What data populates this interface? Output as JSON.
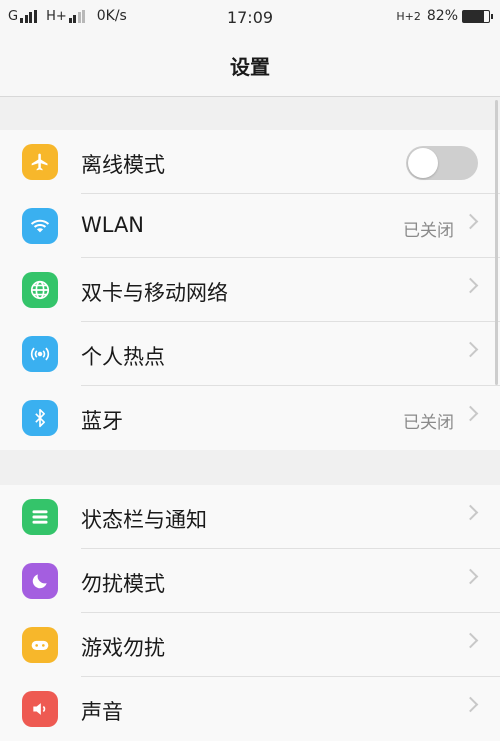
{
  "status_bar": {
    "net1": "G",
    "net2": "H+",
    "speed": "0K/s",
    "time": "17:09",
    "right_net": "H+2",
    "battery": "82%",
    "battery_level": 82
  },
  "nav": {
    "title": "设置"
  },
  "groups": [
    {
      "items": [
        {
          "label": "离线模式",
          "icon": "airplane-icon",
          "color": "#f7b72b",
          "control": "toggle",
          "toggle_on": false
        },
        {
          "label": "WLAN",
          "icon": "wifi-icon",
          "color": "#3ab0f0",
          "status": "已关闭"
        },
        {
          "label": "双卡与移动网络",
          "icon": "globe-icon",
          "color": "#34c46a"
        },
        {
          "label": "个人热点",
          "icon": "hotspot-icon",
          "color": "#3ab0f0"
        },
        {
          "label": "蓝牙",
          "icon": "bluetooth-icon",
          "color": "#3ab0f0",
          "status": "已关闭"
        }
      ]
    },
    {
      "items": [
        {
          "label": "状态栏与通知",
          "icon": "notification-icon",
          "color": "#34c46a"
        },
        {
          "label": "勿扰模式",
          "icon": "moon-icon",
          "color": "#a45ee0"
        },
        {
          "label": "游戏勿扰",
          "icon": "gamepad-icon",
          "color": "#f7b72b"
        },
        {
          "label": "声音",
          "icon": "speaker-icon",
          "color": "#ee5a52"
        }
      ]
    }
  ]
}
